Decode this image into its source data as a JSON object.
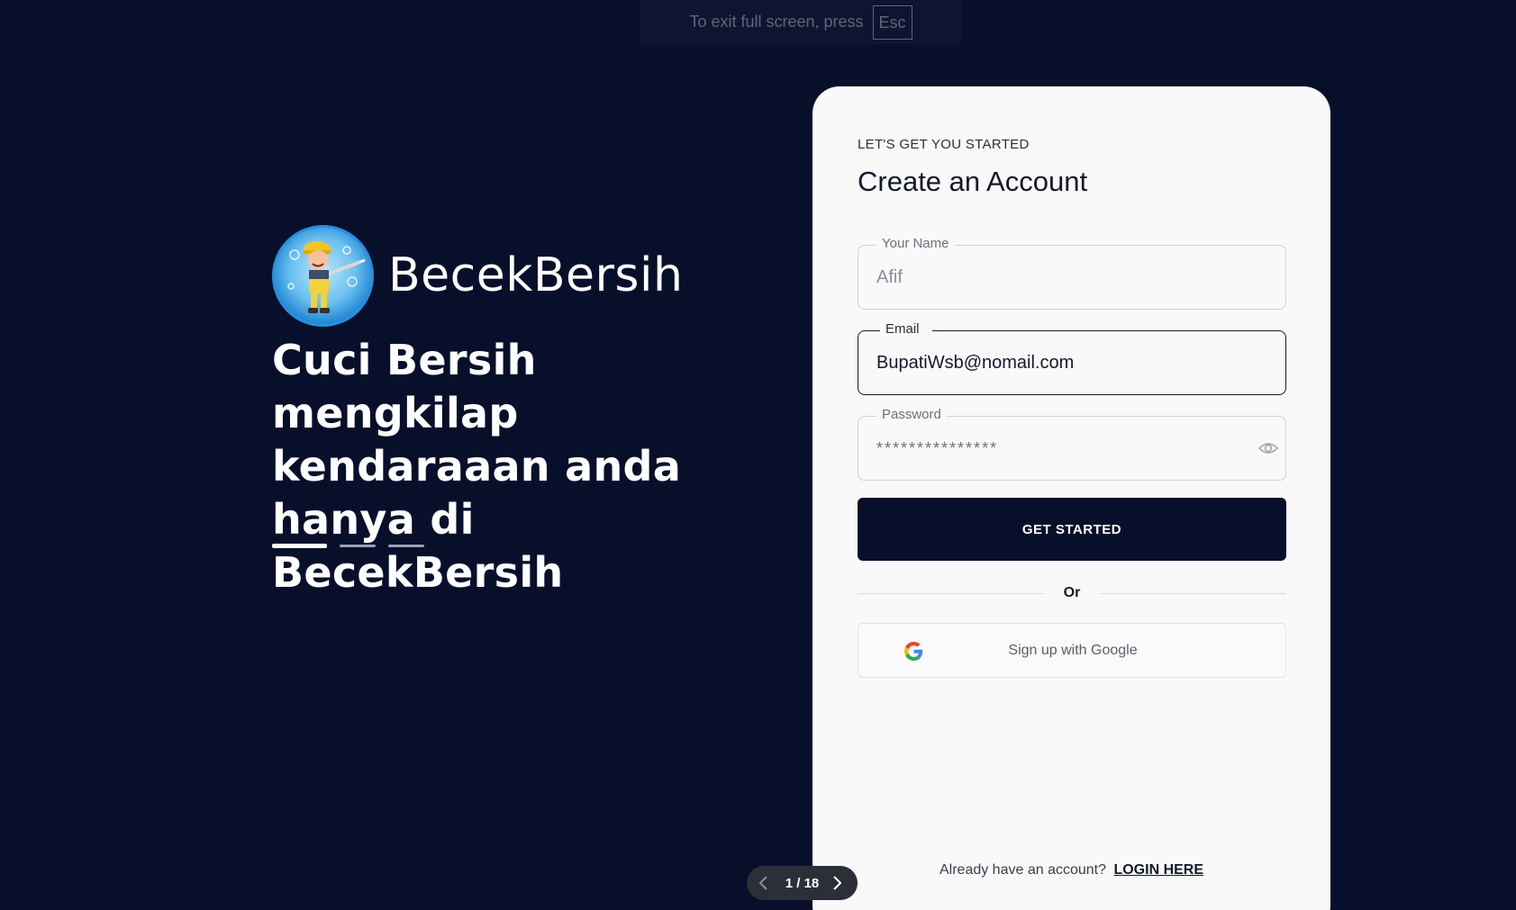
{
  "fullscreen_notice": {
    "text": "To exit full screen, press",
    "key": "Esc"
  },
  "hero": {
    "brand_name": "BecekBersih",
    "tagline": "Cuci Bersih mengkilap kendaraaan anda hanya di BecekBersih",
    "carousel_slides": 3,
    "carousel_active": 1
  },
  "signup": {
    "kicker": "LET'S GET YOU STARTED",
    "title": "Create an Account",
    "fields": {
      "name": {
        "label": "Your Name",
        "value": "Afif"
      },
      "email": {
        "label": "Email",
        "value": "BupatiWsb@nomail.com"
      },
      "password": {
        "label": "Password",
        "value": "***************"
      }
    },
    "submit_label": "GET STARTED",
    "divider_label": "Or",
    "google_label": "Sign up with Google",
    "login_prompt": "Already have an account?",
    "login_link": "LOGIN HERE"
  },
  "pager": {
    "text": "1 / 18"
  },
  "colors": {
    "background": "#080f2b",
    "card": "#f9f9f9",
    "primary_button": "#080f2b"
  },
  "icons": [
    "mascot-logo",
    "eye-icon",
    "google-icon",
    "chevron-left-icon",
    "chevron-right-icon"
  ]
}
